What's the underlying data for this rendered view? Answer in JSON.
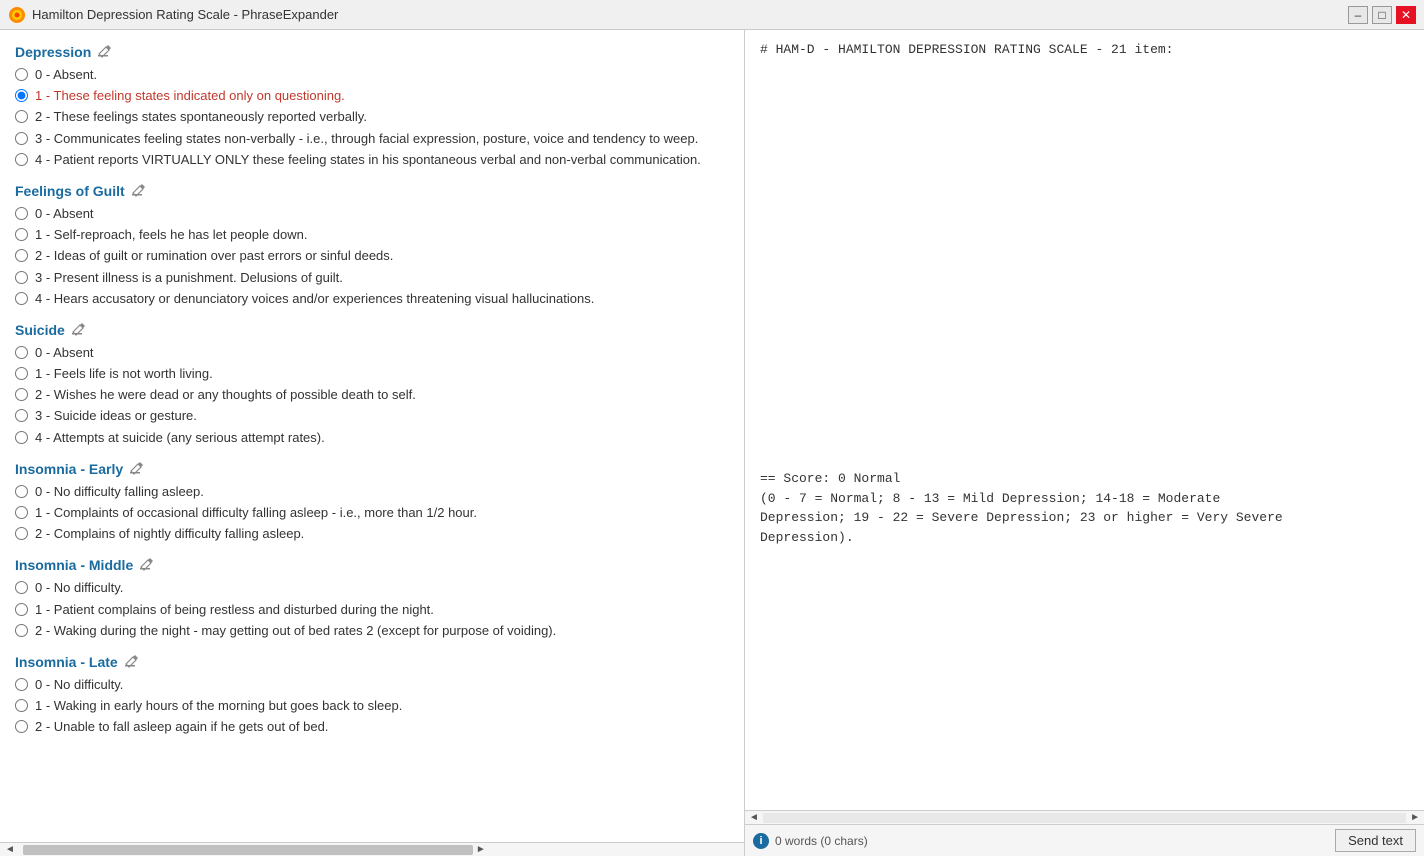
{
  "window": {
    "title": "Hamilton Depression Rating Scale - PhraseExpander",
    "minimize_label": "–",
    "maximize_label": "□",
    "close_label": "✕"
  },
  "right_panel": {
    "content": "# HAM-D - HAMILTON DEPRESSION RATING SCALE - 21 item:\n\n\n\n\n\n\n\n\n\n\n\n\n\n\n\n\n\n\n\n\n\n== Score: 0 Normal\n(0 - 7 = Normal; 8 - 13 = Mild Depression; 14-18 = Moderate\nDepression; 19 - 22 = Severe Depression; 23 or higher = Very Severe\nDepression)."
  },
  "bottom_bar": {
    "word_count": "0 words (0 chars)",
    "send_text_label": "Send text"
  },
  "sections": [
    {
      "id": "depression",
      "label": "Depression",
      "options": [
        {
          "value": "0",
          "text": "0 - Absent.",
          "selected": false
        },
        {
          "value": "1",
          "text": "1 - These feeling states indicated only on questioning.",
          "selected": true
        },
        {
          "value": "2",
          "text": "2 - These feelings states spontaneously reported verbally.",
          "selected": false
        },
        {
          "value": "3",
          "text": "3 - Communicates feeling states non-verbally - i.e., through facial expression, posture, voice and tendency to weep.",
          "selected": false
        },
        {
          "value": "4",
          "text": "4 - Patient reports VIRTUALLY ONLY these feeling states in his spontaneous verbal and non-verbal communication.",
          "selected": false
        }
      ]
    },
    {
      "id": "feelings-of-guilt",
      "label": "Feelings of Guilt",
      "options": [
        {
          "value": "0",
          "text": "0 - Absent",
          "selected": false
        },
        {
          "value": "1",
          "text": "1 - Self-reproach, feels he has let people down.",
          "selected": false
        },
        {
          "value": "2",
          "text": "2 - Ideas of guilt or rumination over past errors or sinful deeds.",
          "selected": false
        },
        {
          "value": "3",
          "text": "3 - Present illness is a punishment. Delusions of guilt.",
          "selected": false
        },
        {
          "value": "4",
          "text": "4 - Hears accusatory or denunciatory voices and/or experiences threatening visual hallucinations.",
          "selected": false
        }
      ]
    },
    {
      "id": "suicide",
      "label": "Suicide",
      "options": [
        {
          "value": "0",
          "text": "0 - Absent",
          "selected": false
        },
        {
          "value": "1",
          "text": "1 - Feels life is not worth living.",
          "selected": false
        },
        {
          "value": "2",
          "text": "2 - Wishes he were dead or any thoughts of possible death to self.",
          "selected": false
        },
        {
          "value": "3",
          "text": "3 - Suicide ideas or gesture.",
          "selected": false
        },
        {
          "value": "4",
          "text": "4 - Attempts at suicide (any serious attempt rates).",
          "selected": false
        }
      ]
    },
    {
      "id": "insomnia-early",
      "label": "Insomnia - Early",
      "options": [
        {
          "value": "0",
          "text": "0 - No difficulty falling asleep.",
          "selected": false
        },
        {
          "value": "1",
          "text": "1 - Complaints of occasional difficulty falling asleep - i.e., more than 1/2 hour.",
          "selected": false
        },
        {
          "value": "2",
          "text": "2 - Complains of nightly difficulty falling asleep.",
          "selected": false
        }
      ]
    },
    {
      "id": "insomnia-middle",
      "label": "Insomnia - Middle",
      "options": [
        {
          "value": "0",
          "text": "0 - No difficulty.",
          "selected": false
        },
        {
          "value": "1",
          "text": "1 - Patient complains of being restless and disturbed during the night.",
          "selected": false
        },
        {
          "value": "2",
          "text": "2 - Waking during the night - may getting out of bed rates 2 (except for purpose of voiding).",
          "selected": false
        }
      ]
    },
    {
      "id": "insomnia-late",
      "label": "Insomnia - Late",
      "options": [
        {
          "value": "0",
          "text": "0 - No difficulty.",
          "selected": false
        },
        {
          "value": "1",
          "text": "1 - Waking in early hours of the morning but goes back to sleep.",
          "selected": false
        },
        {
          "value": "2",
          "text": "2 - Unable to fall asleep again if he gets out of bed.",
          "selected": false
        }
      ]
    }
  ]
}
